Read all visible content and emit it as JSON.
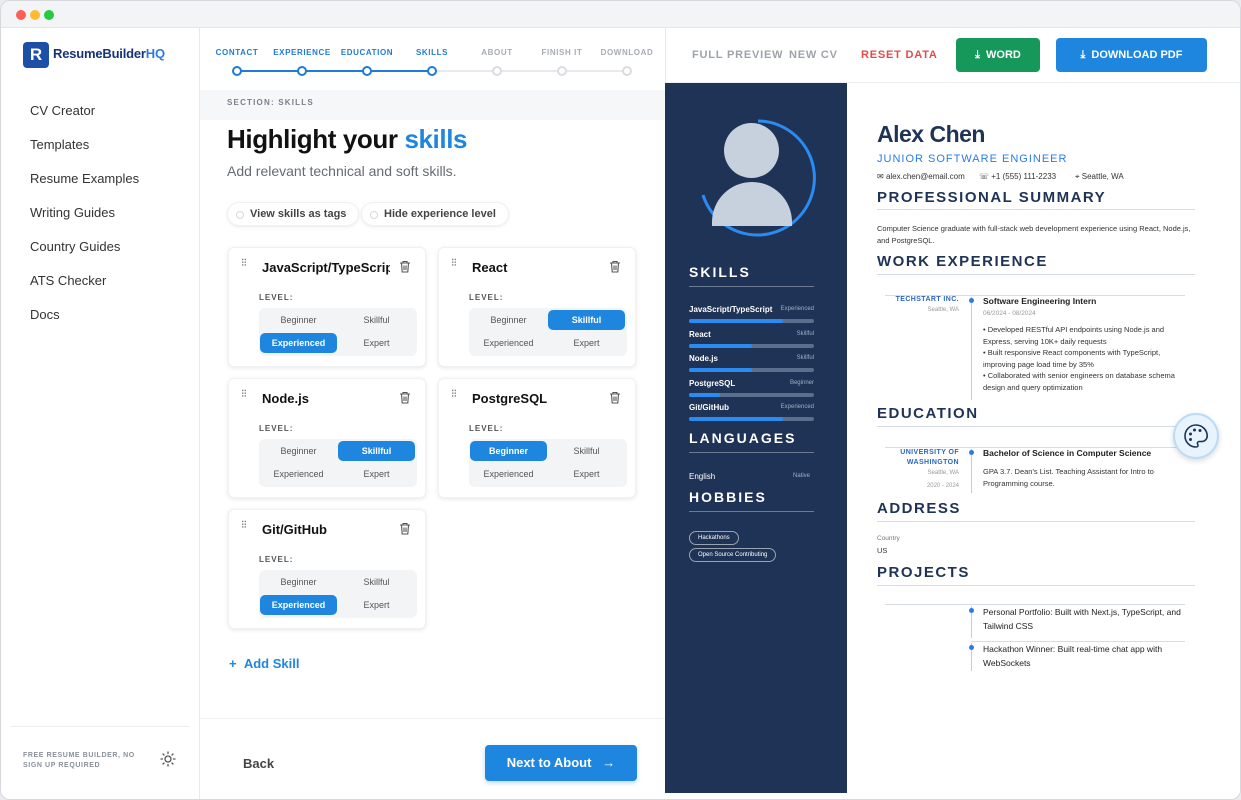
{
  "window": {
    "chrome_colors": [
      "#fe5f57",
      "#febc2e",
      "#28c840"
    ]
  },
  "brand": {
    "name_a": "ResumeBuilder",
    "name_b": "HQ",
    "mark": "R",
    "color": "#16337a",
    "accent": "#1f86e0"
  },
  "sidebar": {
    "items": [
      {
        "label": "CV Creator"
      },
      {
        "label": "Templates"
      },
      {
        "label": "Resume Examples"
      },
      {
        "label": "Writing Guides"
      },
      {
        "label": "Country Guides"
      },
      {
        "label": "ATS Checker"
      },
      {
        "label": "Docs"
      }
    ],
    "footer_text": "FREE RESUME BUILDER, NO SIGN UP REQUIRED",
    "theme_icon": "sun-icon"
  },
  "stepper": {
    "steps": [
      {
        "label": "CONTACT",
        "state": "done"
      },
      {
        "label": "EXPERIENCE",
        "state": "done"
      },
      {
        "label": "EDUCATION",
        "state": "done"
      },
      {
        "label": "SKILLS",
        "state": "current"
      },
      {
        "label": "ABOUT",
        "state": "pending"
      },
      {
        "label": "FINISH IT",
        "state": "pending"
      },
      {
        "label": "DOWNLOAD",
        "state": "pending"
      }
    ]
  },
  "editor": {
    "section_label": "SECTION: SKILLS",
    "headline_plain": "Highlight your",
    "headline_accent": "skills",
    "subline": "Add relevant technical and soft skills.",
    "pill_tags": "View skills as tags",
    "pill_hide": "Hide experience level",
    "level_label": "LEVEL:",
    "level_options": [
      "Beginner",
      "Skillful",
      "Experienced",
      "Expert"
    ],
    "skills": [
      {
        "name": "JavaScript/TypeScript",
        "selected": "Experienced"
      },
      {
        "name": "React",
        "selected": "Skillful"
      },
      {
        "name": "Node.js",
        "selected": "Skillful"
      },
      {
        "name": "PostgreSQL",
        "selected": "Beginner"
      },
      {
        "name": "Git/GitHub",
        "selected": "Experienced"
      }
    ],
    "add_skill": "Add Skill",
    "back": "Back",
    "next": "Next to About"
  },
  "toolbar": {
    "full_preview": "FULL PREVIEW",
    "new_cv": "NEW CV",
    "reset": "RESET DATA",
    "word": "WORD",
    "pdf": "DOWNLOAD PDF",
    "word_color": "#16985a",
    "reset_color": "#e24b4b"
  },
  "resume": {
    "sidebar_color": "#1f3356",
    "skills_heading": "SKILLS",
    "skills": [
      {
        "name": "JavaScript/TypeScript",
        "level": "Experienced",
        "fill": 0.75
      },
      {
        "name": "React",
        "level": "Skillful",
        "fill": 0.5
      },
      {
        "name": "Node.js",
        "level": "Skillful",
        "fill": 0.5
      },
      {
        "name": "PostgreSQL",
        "level": "Beginner",
        "fill": 0.25
      },
      {
        "name": "Git/GitHub",
        "level": "Experienced",
        "fill": 0.75
      }
    ],
    "languages_heading": "LANGUAGES",
    "language": {
      "name": "English",
      "level": "Native"
    },
    "hobbies_heading": "HOBBIES",
    "hobbies": [
      "Hackathons",
      "Open Source Contributing"
    ],
    "name": "Alex Chen",
    "role": "JUNIOR SOFTWARE ENGINEER",
    "email": "alex.chen@email.com",
    "phone": "+1 (555) 111-2233",
    "location": "Seattle, WA",
    "summary_heading": "PROFESSIONAL SUMMARY",
    "summary": "Computer Science graduate with full-stack web development experience using React, Node.js, and PostgreSQL.",
    "work_heading": "WORK EXPERIENCE",
    "work": {
      "org": "TECHSTART INC.",
      "place": "Seattle, WA",
      "title": "Software Engineering Intern",
      "dates": "06/2024 - 08/2024",
      "bullets": [
        "• Developed RESTful API endpoints using Node.js and Express, serving 10K+ daily requests",
        "• Built responsive React components with TypeScript, improving page load time by 35%",
        "• Collaborated with senior engineers on database schema design and query optimization"
      ]
    },
    "education_heading": "EDUCATION",
    "education": {
      "org": "UNIVERSITY OF WASHINGTON",
      "place": "Seattle, WA",
      "dates": "2020 - 2024",
      "title": "Bachelor of Science in Computer Science",
      "body": "GPA 3.7. Dean's List. Teaching Assistant for Intro to Programming course."
    },
    "address_heading": "ADDRESS",
    "country_label": "Country",
    "country": "US",
    "projects_heading": "PROJECTS",
    "projects": [
      "Personal Portfolio: Built with Next.js, TypeScript, and Tailwind CSS",
      "Hackathon Winner: Built real-time chat app with WebSockets"
    ]
  }
}
